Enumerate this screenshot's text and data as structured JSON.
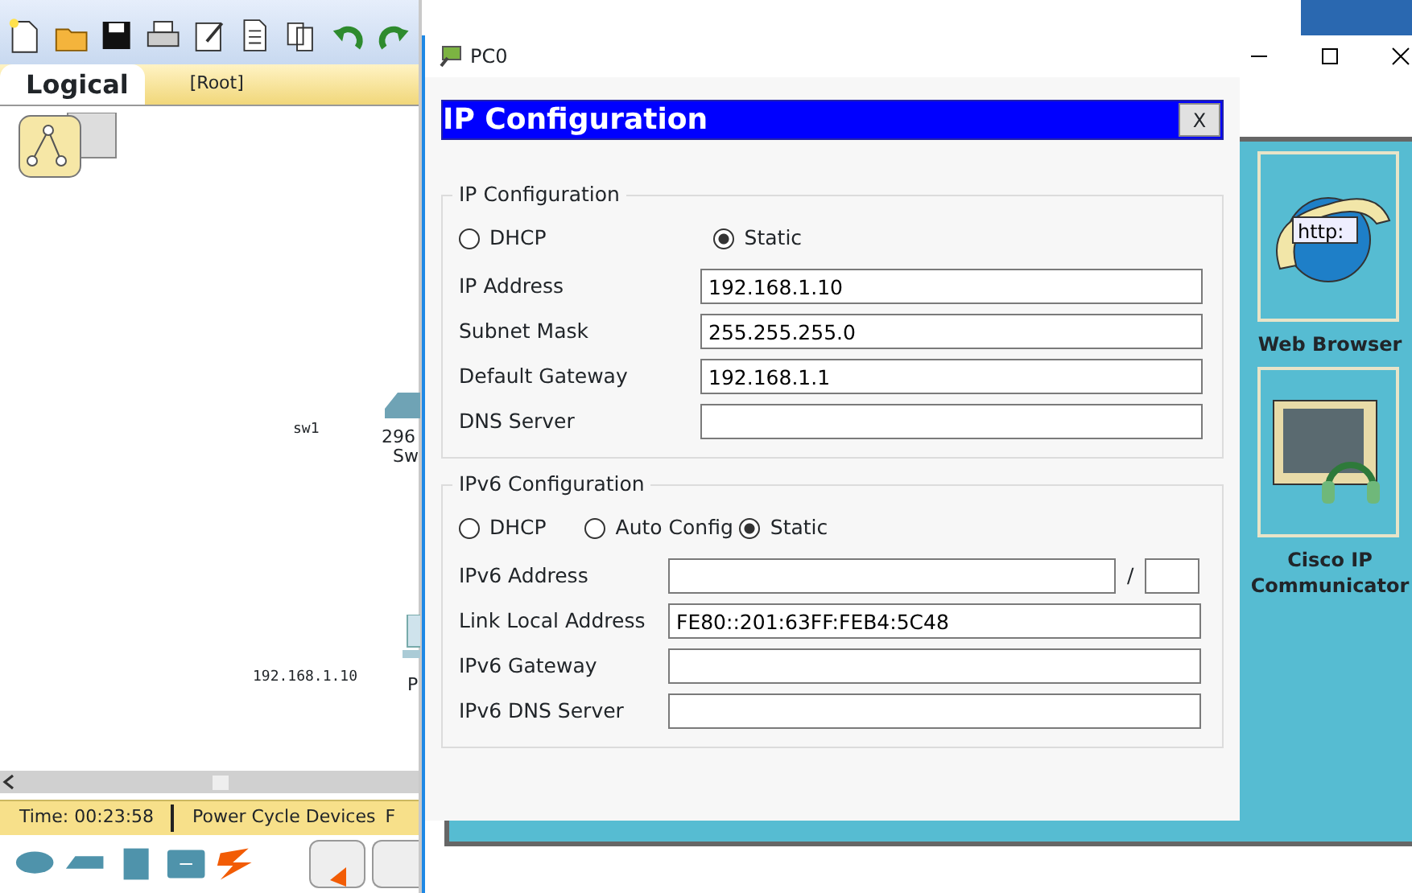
{
  "app": {
    "tab": "Logical",
    "root_label": "[Root]",
    "devices": [
      {
        "kind": "switch",
        "labels": [
          "sw1",
          "296",
          "Sw"
        ]
      },
      {
        "kind": "pc",
        "labels": [
          "192.168.1.10",
          "P"
        ]
      }
    ],
    "status_bar": {
      "time": "Time: 00:23:58",
      "button": "Power Cycle Devices",
      "cut_text": "F"
    }
  },
  "dialog": {
    "title": "PC0",
    "panel_title": "IP Configuration",
    "close_label": "X",
    "ipv4": {
      "legend": "IP Configuration",
      "modes": [
        {
          "label": "DHCP",
          "selected": false
        },
        {
          "label": "Static",
          "selected": true
        }
      ],
      "fields": [
        {
          "label": "IP Address",
          "value": "192.168.1.10"
        },
        {
          "label": "Subnet Mask",
          "value": "255.255.255.0"
        },
        {
          "label": "Default Gateway",
          "value": "192.168.1.1"
        },
        {
          "label": "DNS Server"
        }
      ]
    },
    "ipv6": {
      "legend": "IPv6 Configuration",
      "modes": [
        {
          "label": "DHCP",
          "selected": false
        },
        {
          "label": "Auto Config",
          "selected": false
        },
        {
          "label": "Static",
          "selected": true
        }
      ],
      "fields": [
        {
          "label": "IPv6 Address",
          "kind": "prefix",
          "separator": "/"
        },
        {
          "label": "Link Local Address",
          "value": "FE80::201:63FF:FEB4:5C48"
        },
        {
          "label": "IPv6 Gateway"
        },
        {
          "label": "IPv6 DNS Server"
        }
      ]
    },
    "apps": [
      {
        "label": "Web Browser",
        "kind": "browser",
        "icon_text": "http:"
      },
      {
        "label": "Cisco IP Communicator",
        "kind": "phone"
      }
    ]
  }
}
